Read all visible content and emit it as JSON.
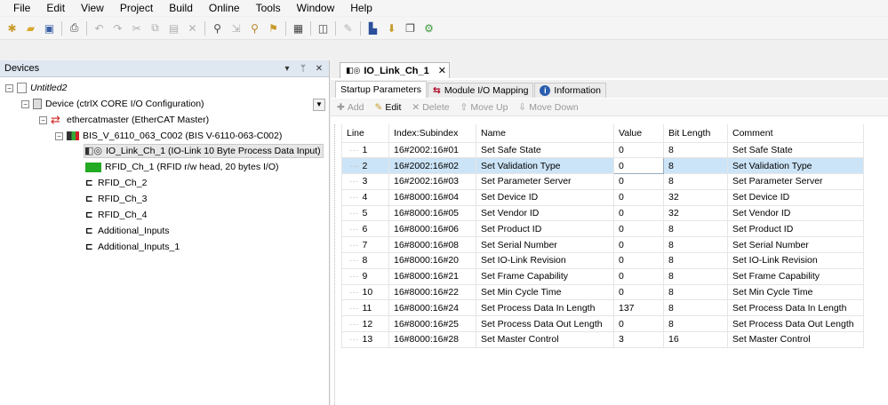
{
  "menu": [
    "File",
    "Edit",
    "View",
    "Project",
    "Build",
    "Online",
    "Tools",
    "Window",
    "Help"
  ],
  "toolbar_icons": [
    "new-project-icon",
    "open-project-icon",
    "save-project-icon",
    "print-icon",
    "undo-icon",
    "redo-icon",
    "cut-icon",
    "copy-icon",
    "paste-icon",
    "delete-icon",
    "find-icon",
    "find-next-icon",
    "replace-icon",
    "bookmark-icon",
    "select-all-icon",
    "properties-icon",
    "build-icon",
    "login-icon",
    "download-icon",
    "simulate-icon"
  ],
  "devices": {
    "title": "Devices",
    "controls": [
      "▾",
      "ᛘ",
      "✕"
    ],
    "tree": [
      {
        "label": "Untitled2",
        "italic": true
      },
      {
        "label": "Device (ctrlX CORE I/O Configuration)"
      },
      {
        "label": "ethercatmaster (EtherCAT Master)"
      },
      {
        "label": "BIS_V_6110_063_C002 (BIS V-6110-063-C002)"
      },
      {
        "label": "IO_Link_Ch_1 (IO-Link 10 Byte Process Data Input)"
      },
      {
        "label": "RFID_Ch_1 (RFID r/w head, 20 bytes I/O)"
      },
      {
        "label": "RFID_Ch_2"
      },
      {
        "label": "RFID_Ch_3"
      },
      {
        "label": "RFID_Ch_4"
      },
      {
        "label": "Additional_Inputs"
      },
      {
        "label": "Additional_Inputs_1"
      }
    ]
  },
  "editor": {
    "doc_tab": "IO_Link_Ch_1",
    "close": "✕",
    "subtabs": [
      "Startup Parameters",
      "Module I/O Mapping",
      "Information"
    ],
    "actions": [
      "Add",
      "Edit",
      "Delete",
      "Move Up",
      "Move Down"
    ],
    "columns": [
      "Line",
      "Index:Subindex",
      "Name",
      "Value",
      "Bit Length",
      "Comment"
    ],
    "rows": [
      [
        "1",
        "16#2002:16#01",
        "Set Safe State",
        "0",
        "8",
        "Set Safe State"
      ],
      [
        "2",
        "16#2002:16#02",
        "Set Validation Type",
        "0",
        "8",
        "Set Validation Type"
      ],
      [
        "3",
        "16#2002:16#03",
        "Set Parameter Server",
        "0",
        "8",
        "Set Parameter Server"
      ],
      [
        "4",
        "16#8000:16#04",
        "Set Device ID",
        "0",
        "32",
        "Set Device ID"
      ],
      [
        "5",
        "16#8000:16#05",
        "Set Vendor ID",
        "0",
        "32",
        "Set Vendor ID"
      ],
      [
        "6",
        "16#8000:16#06",
        "Set Product ID",
        "0",
        "8",
        "Set Product ID"
      ],
      [
        "7",
        "16#8000:16#08",
        "Set Serial Number",
        "0",
        "8",
        "Set Serial Number"
      ],
      [
        "8",
        "16#8000:16#20",
        "Set IO-Link Revision",
        "0",
        "8",
        "Set IO-Link Revision"
      ],
      [
        "9",
        "16#8000:16#21",
        "Set Frame Capability",
        "0",
        "8",
        "Set Frame Capability"
      ],
      [
        "10",
        "16#8000:16#22",
        "Set Min Cycle Time",
        "0",
        "8",
        "Set Min Cycle Time"
      ],
      [
        "11",
        "16#8000:16#24",
        "Set Process Data In Length",
        "137",
        "8",
        "Set Process Data In Length"
      ],
      [
        "12",
        "16#8000:16#25",
        "Set Process Data Out Length",
        "0",
        "8",
        "Set Process Data Out Length"
      ],
      [
        "13",
        "16#8000:16#28",
        "Set Master Control",
        "3",
        "16",
        "Set Master Control"
      ]
    ],
    "selected_row": 1
  }
}
